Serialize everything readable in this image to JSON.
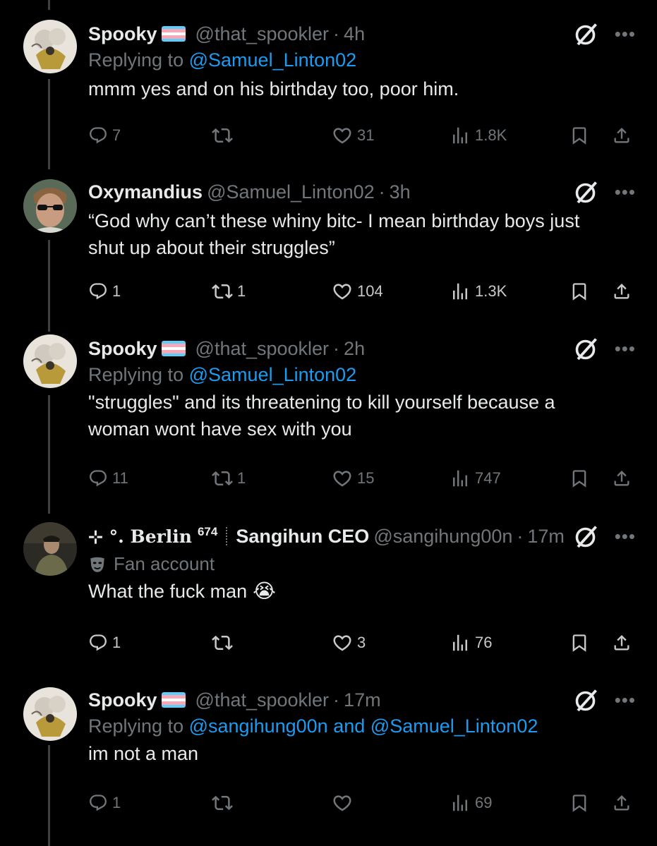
{
  "tweets": [
    {
      "name": "Spooky",
      "handle": "@that_spookler",
      "time": "4h",
      "reply_prefix": "Replying to",
      "reply_to": "@Samuel_Linton02",
      "text": "mmm yes and on his birthday too, poor him.",
      "replies": "7",
      "retweets": "",
      "likes": "31",
      "views": "1.8K"
    },
    {
      "name": "Oxymandius",
      "handle": "@Samuel_Linton02",
      "time": "3h",
      "text_lines": [
        "“God why can’t these whiny bitc- I mean birthday boys just",
        "shut up about their struggles”"
      ],
      "replies": "1",
      "retweets": "1",
      "likes": "104",
      "views": "1.3K"
    },
    {
      "name": "Spooky",
      "handle": "@that_spookler",
      "time": "2h",
      "reply_prefix": "Replying to",
      "reply_to": "@Samuel_Linton02",
      "text_lines": [
        "\"struggles\" and its threatening to kill yourself because a",
        "woman wont have sex with you"
      ],
      "replies": "11",
      "retweets": "1",
      "likes": "15",
      "views": "747"
    },
    {
      "name_prefix": "⊹ °. Berlin",
      "name_number": "674",
      "name": "Sangihun CEO",
      "handle": "@sangihung00n",
      "time": "17m",
      "label": "Fan account",
      "text": "What the fuck man",
      "emoji": "😭",
      "replies": "1",
      "retweets": "",
      "likes": "3",
      "views": "76"
    },
    {
      "name": "Spooky",
      "handle": "@that_spookler",
      "time": "17m",
      "reply_prefix": "Replying to",
      "reply_to": "@sangihung00n",
      "reply_and": "and",
      "reply_to_2": "@Samuel_Linton02",
      "text": "im not a man",
      "replies": "1",
      "retweets": "",
      "likes": "",
      "views": "69"
    }
  ],
  "icons": {
    "reply": "reply-icon",
    "retweet": "retweet-icon",
    "like": "heart-icon",
    "views": "views-icon",
    "bookmark": "bookmark-icon",
    "share": "share-icon",
    "grok": "grok-icon",
    "more": "more-icon"
  },
  "colors": {
    "background": "#000000",
    "text": "#e7e9ea",
    "muted": "#71767b",
    "link": "#1d9bf0",
    "flag_blue": "#5BCEFA",
    "flag_pink": "#F5A9B8",
    "flag_white": "#FFFFFF"
  }
}
